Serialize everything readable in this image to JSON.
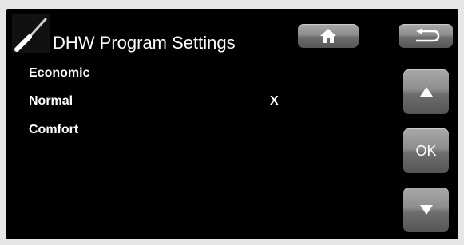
{
  "header": {
    "title": "DHW Program Settings",
    "icon": "screwdriver-icon"
  },
  "nav": {
    "home_icon": "home-icon",
    "back_icon": "back-arrow-icon"
  },
  "side_buttons": {
    "up_icon": "arrow-up-icon",
    "ok_label": "OK",
    "down_icon": "arrow-down-icon"
  },
  "options": [
    {
      "label": "Economic",
      "mark": ""
    },
    {
      "label": "Normal",
      "mark": "X"
    },
    {
      "label": "Comfort",
      "mark": ""
    }
  ],
  "colors": {
    "background": "#000000",
    "text": "#ffffff",
    "button": "#8d8d8d"
  }
}
